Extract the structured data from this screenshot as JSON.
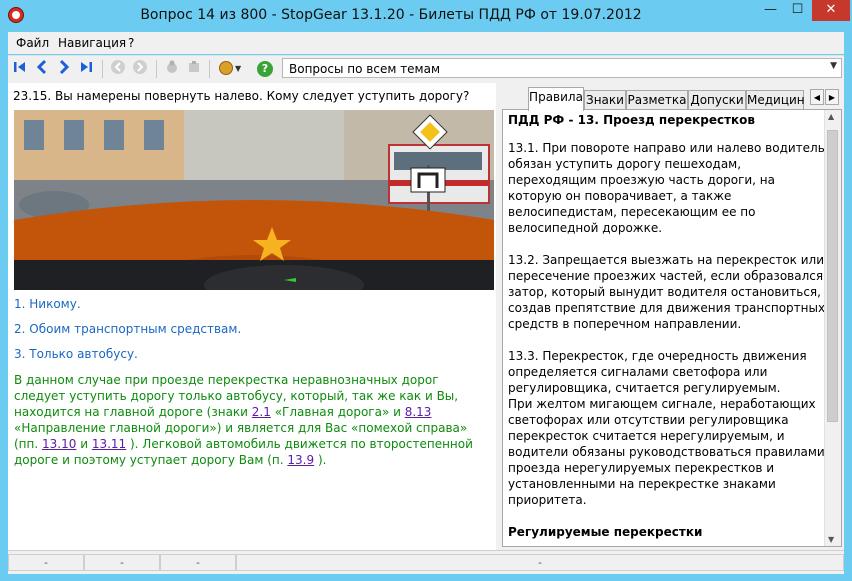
{
  "window": {
    "title": "Вопрос 14 из 800 - StopGear 13.1.20 - Билеты ПДД РФ от 19.07.2012",
    "minimize": "—",
    "maximize": "☐",
    "close": "✕"
  },
  "menu": {
    "file": "Файл",
    "navigation": "Навигация",
    "help": "?"
  },
  "toolbar": {
    "first": "K",
    "prev": "<",
    "next": ">",
    "last": "›|",
    "topics_combo": "Вопросы по всем темам",
    "combo_arrow": "▼"
  },
  "question": {
    "text": "23.15. Вы намерены повернуть налево. Кому следует уступить дорогу?",
    "answers": [
      "1. Никому.",
      "2. Обоим транспортным средствам.",
      "3. Только автобусу."
    ],
    "explanation": {
      "p1": "В данном случае при проезде перекрестка неравнозначных дорог следует уступить дорогу только автобусу, который, так же как и Вы, находится на главной дороге (знаки ",
      "link1": "2.1",
      "p2": " «Главная дорога» и ",
      "link2": "8.13",
      "p3": " «Направление главной дороги») и является для Вас «помехой справа» (пп. ",
      "link3": "13.10",
      "p4": " и ",
      "link4": "13.11",
      "p5": " ). Легковой автомобиль движется по второстепенной дороге и поэтому уступает дорогу Вам (п. ",
      "link5": "13.9",
      "p6": " )."
    }
  },
  "tabs": [
    "Правила",
    "Знаки",
    "Разметка",
    "Допуски",
    "Медицин"
  ],
  "tab_scroll": {
    "left": "◀",
    "right": "▶"
  },
  "rules": {
    "heading": "ПДД РФ -   13. Проезд перекрестков",
    "paragraphs": [
      "13.1. При повороте направо или налево водитель обязан уступить дорогу пешеходам, переходящим проезжую часть дороги, на которую он поворачивает, а также велосипедистам, пересекающим ее по велосипедной дорожке.",
      "13.2. Запрещается выезжать на перекресток или пересечение проезжих частей, если образовался затор, который вынудит водителя остановиться, создав препятствие для движения транспортных средств в поперечном направлении.",
      "13.3. Перекресток, где очередность движения определяется сигналами светофора или регулировщика, считается регулируемым.\n   При желтом мигающем сигнале, неработающих светофорах или отсутствии регулировщика перекресток считается нерегулируемым, и водители обязаны руководствоваться правилами проезда нерегулируемых перекрестков и установленными на перекрестке знаками приоритета."
    ],
    "subheading": "Регулируемые перекрестки"
  },
  "scrollbar": {
    "up": "▲",
    "down": "▼"
  },
  "status": [
    "-",
    "-",
    "-",
    "-"
  ],
  "colors": {
    "titlebar": "#6ccbf0",
    "answer_text": "#1b68c3",
    "explanation_text": "#0f8a0f",
    "link": "#5a1ba5"
  }
}
